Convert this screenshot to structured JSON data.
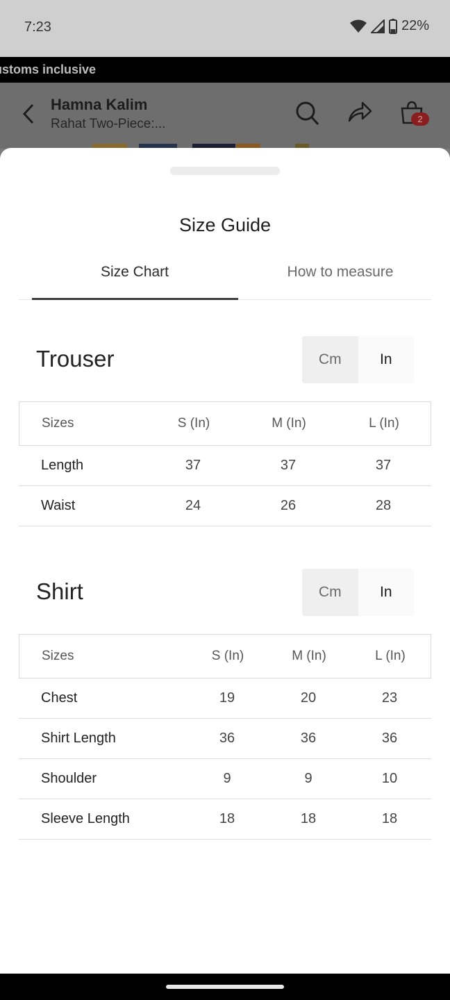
{
  "status_bar": {
    "time": "7:23",
    "battery": "22%"
  },
  "banner": {
    "text": "ustoms inclusive"
  },
  "app_header": {
    "brand": "Hamna Kalim",
    "product": "Rahat Two-Piece:...",
    "cart_count": "2"
  },
  "sheet": {
    "title": "Size Guide",
    "tabs": [
      {
        "label": "Size Chart",
        "active": true
      },
      {
        "label": "How to measure",
        "active": false
      }
    ]
  },
  "trouser": {
    "title": "Trouser",
    "unit_toggle": {
      "cm": "Cm",
      "in": "In",
      "selected": "In"
    },
    "headers": [
      "Sizes",
      "S (In)",
      "M (In)",
      "L (In)"
    ],
    "rows": [
      {
        "label": "Length",
        "values": [
          "37",
          "37",
          "37"
        ]
      },
      {
        "label": "Waist",
        "values": [
          "24",
          "26",
          "28"
        ]
      }
    ]
  },
  "shirt": {
    "title": "Shirt",
    "unit_toggle": {
      "cm": "Cm",
      "in": "In",
      "selected": "In"
    },
    "headers": [
      "Sizes",
      "S (In)",
      "M (In)",
      "L (In)"
    ],
    "rows": [
      {
        "label": "Chest",
        "values": [
          "19",
          "20",
          "23"
        ]
      },
      {
        "label": "Shirt Length",
        "values": [
          "36",
          "36",
          "36"
        ]
      },
      {
        "label": "Shoulder",
        "values": [
          "9",
          "9",
          "10"
        ]
      },
      {
        "label": "Sleeve Length",
        "values": [
          "18",
          "18",
          "18"
        ]
      }
    ]
  },
  "colors": {
    "accent_indicator": "#3b3b3b",
    "badge": "#8a1e1e"
  }
}
